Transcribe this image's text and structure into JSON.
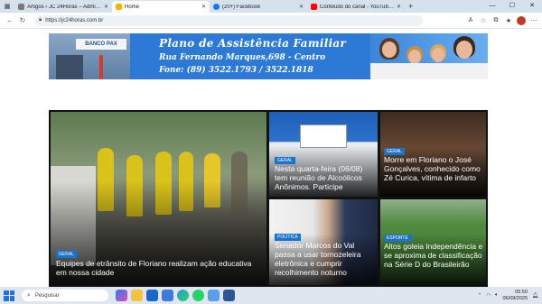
{
  "browser": {
    "tabs": [
      {
        "label": "Artigos ‹ JC 24Horas – Administrar",
        "active": false,
        "color": "#7a7a7a"
      },
      {
        "label": "Home",
        "active": true,
        "color": "#f5b400"
      },
      {
        "label": "(20+) Facebook",
        "active": false,
        "color": "#1877f2"
      },
      {
        "label": "Conteúdo do canal - YouTube Studio",
        "active": false,
        "color": "#ff0000"
      }
    ],
    "url": "https://jc24horas.com.br",
    "window_controls": [
      "—",
      "☐",
      "✕"
    ]
  },
  "banner": {
    "shop_sign": "BANCO PAX",
    "title": "Plano de Assistência Familiar",
    "address": "Rua Fernando Marques,698 - Centro",
    "phone": "Fone: (89) 3522.1793 / 3522.1818"
  },
  "news": [
    {
      "category": "Geral",
      "headline": "Equipes de etrânsito de Floriano realizam ação educativa em nossa cidade"
    },
    {
      "category": "Geral",
      "headline": "Nesta quarta-feira (06/08) tem reunião de Alcoólicos Anônimos. Participe"
    },
    {
      "category": "Geral",
      "headline": "Morre em Floriano o José Gonçalves, conhecido como Zé Curica, vítima de infarto"
    },
    {
      "category": "Política",
      "headline": "Senador Marcos do Val passa a usar tornozeleira eletrônica e cumprir recolhimento noturno"
    },
    {
      "category": "Esporte",
      "headline": "Altos goleia Independência e se aproxima de classificação na Série D do Brasileirão"
    }
  ],
  "taskbar": {
    "search_placeholder": "Pesquisar",
    "time": "05:50",
    "date": "06/08/2025"
  },
  "colors": {
    "accent": "#1a73c8",
    "banner_blue": "#2d7ad6"
  }
}
